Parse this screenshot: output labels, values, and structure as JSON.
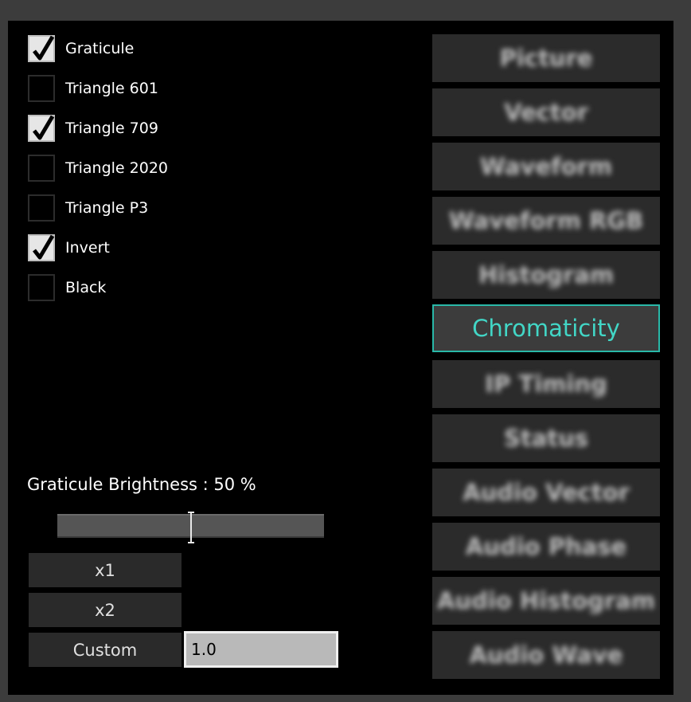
{
  "checkboxes": [
    {
      "label": "Graticule",
      "checked": true
    },
    {
      "label": "Triangle 601",
      "checked": false
    },
    {
      "label": "Triangle 709",
      "checked": true
    },
    {
      "label": "Triangle 2020",
      "checked": false
    },
    {
      "label": "Triangle P3",
      "checked": false
    },
    {
      "label": "Invert",
      "checked": true
    },
    {
      "label": "Black",
      "checked": false
    }
  ],
  "brightness": {
    "label": "Graticule Brightness : 50 %",
    "value": 0.5
  },
  "scale_buttons": {
    "x1": "x1",
    "x2": "x2",
    "custom": "Custom",
    "custom_value": "1.0"
  },
  "views": [
    {
      "label": "Picture",
      "active": false
    },
    {
      "label": "Vector",
      "active": false
    },
    {
      "label": "Waveform",
      "active": false
    },
    {
      "label": "Waveform RGB",
      "active": false
    },
    {
      "label": "Histogram",
      "active": false
    },
    {
      "label": "Chromaticity",
      "active": true
    },
    {
      "label": "IP Timing",
      "active": false
    },
    {
      "label": "Status",
      "active": false
    },
    {
      "label": "Audio Vector",
      "active": false
    },
    {
      "label": "Audio Phase",
      "active": false
    },
    {
      "label": "Audio Histogram",
      "active": false
    },
    {
      "label": "Audio Wave",
      "active": false
    }
  ],
  "colors": {
    "accent": "#42d6c6",
    "accent_border": "#29b8a8",
    "panel_bg": "#000000",
    "frame_bg": "#3c3c3c"
  }
}
